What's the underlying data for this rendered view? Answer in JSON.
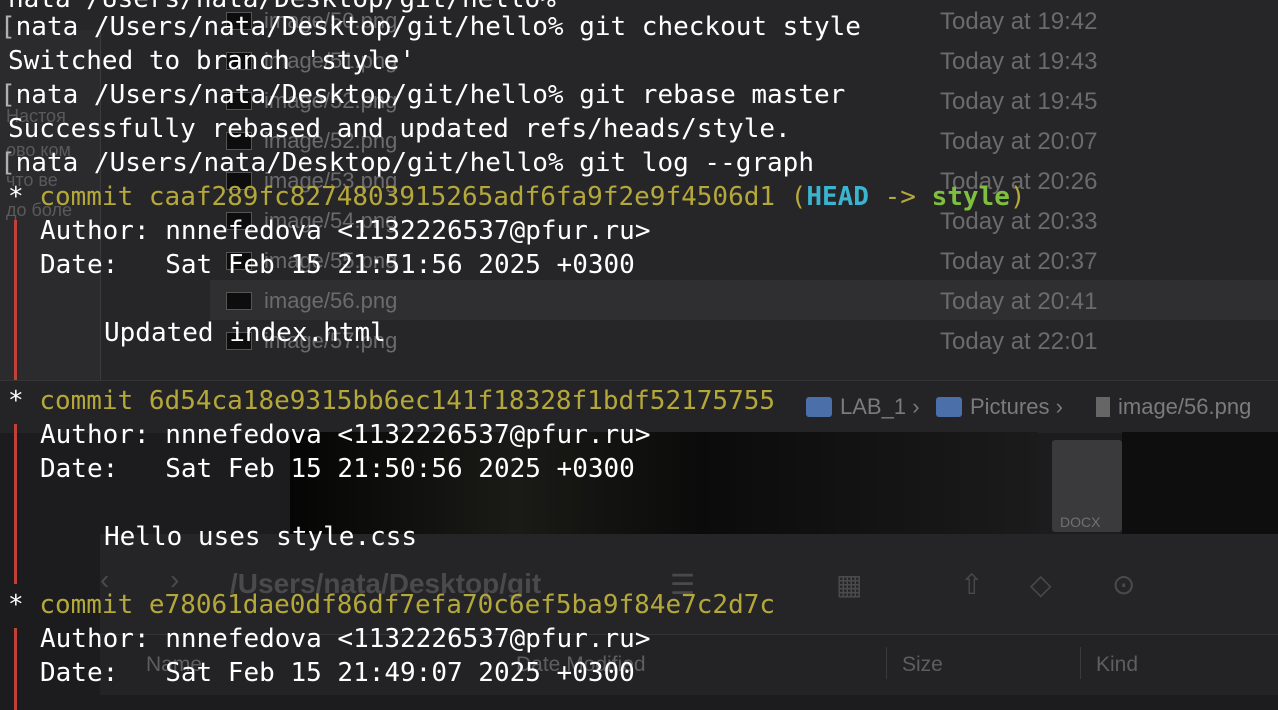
{
  "finder": {
    "files": [
      {
        "name": "image/50.png",
        "date": "Today at 19:42"
      },
      {
        "name": "image/51.png",
        "date": "Today at 19:43"
      },
      {
        "name": "image/52.png",
        "date": "Today at 19:45"
      },
      {
        "name": "image/52.png",
        "date": "Today at 20:07"
      },
      {
        "name": "image/53.png",
        "date": "Today at 20:26"
      },
      {
        "name": "image/54.png",
        "date": "Today at 20:33"
      },
      {
        "name": "image/55.png",
        "date": "Today at 20:37"
      },
      {
        "name": "image/56.png",
        "date": "Today at 20:41"
      },
      {
        "name": "image/57.png",
        "date": "Today at 22:01"
      }
    ],
    "left_panel_text": [
      "Настоя",
      "ово ком",
      "что ве",
      "до боле"
    ],
    "path_bar": {
      "folder1": "LAB_1",
      "folder2": "Pictures",
      "file": "image/56.png",
      "sep": "›"
    },
    "doc_label": "DOCX",
    "window_path": "/Users/nata/Desktop/git",
    "columns": {
      "name": "Name",
      "modified": "Date Modified",
      "size": "Size",
      "kind": "Kind"
    }
  },
  "terminal": {
    "prompt": "nata /Users/nata/Desktop/git/hello% ",
    "top_cut": "nata /Users/nata/Desktop/git/hello%",
    "cmd_checkout": "git checkout style",
    "out_checkout": "Switched to branch 'style'",
    "cmd_rebase": "git rebase master",
    "out_rebase": "Successfully rebased and updated refs/heads/style.",
    "cmd_log": "git log --graph",
    "commits": [
      {
        "word": "commit",
        "sha": "caaf289fc8274803915265adf6fa9f2e9f4506d1",
        "head": "HEAD",
        "arrow": "->",
        "branch": "style",
        "author": "Author: nnnefedova <1132226537@pfur.ru>",
        "date": "Date:   Sat Feb 15 21:51:56 2025 +0300",
        "message": "Updated index.html"
      },
      {
        "word": "commit",
        "sha": "6d54ca18e9315bb6ec141f18328f1bdf52175755",
        "author": "Author: nnnefedova <1132226537@pfur.ru>",
        "date": "Date:   Sat Feb 15 21:50:56 2025 +0300",
        "message": "Hello uses style.css"
      },
      {
        "word": "commit",
        "sha": "e78061dae0df86df7efa70c6ef5ba9f84e7c2d7c",
        "author": "Author: nnnefedova <1132226537@pfur.ru>",
        "date": "Date:   Sat Feb 15 21:49:07 2025 +0300"
      }
    ]
  }
}
